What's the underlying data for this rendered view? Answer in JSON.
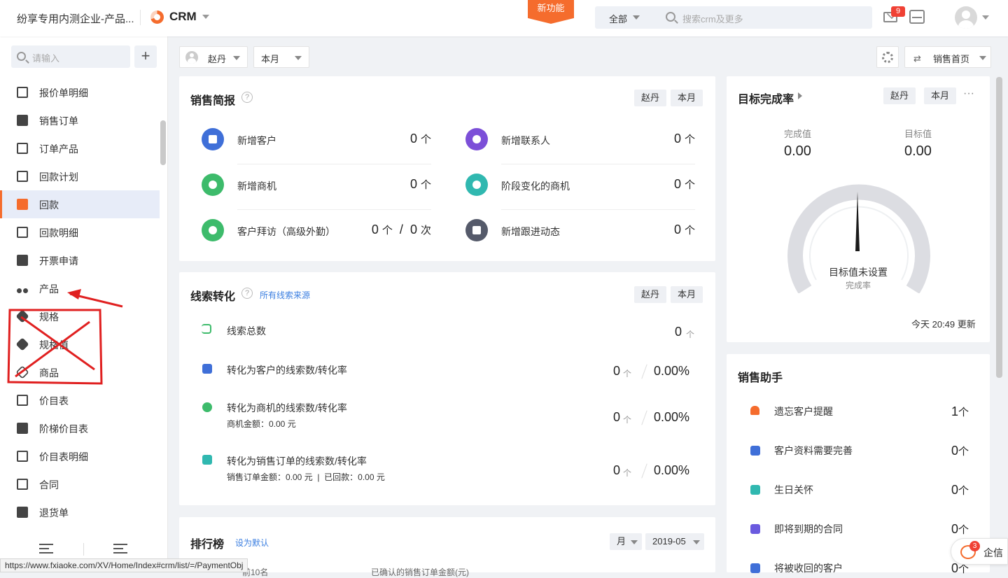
{
  "topbar": {
    "company": "纷享专用内测企业-产品...",
    "app": "CRM",
    "new_feature": "新功能",
    "search_scope": "全部",
    "search_placeholder": "搜索crm及更多",
    "mail_badge": "9"
  },
  "sidebar": {
    "search_placeholder": "请输入",
    "add_label": "+",
    "items": [
      {
        "label": "报价单明细",
        "icon": "quote-detail-icon"
      },
      {
        "label": "销售订单",
        "icon": "sales-order-icon"
      },
      {
        "label": "订单产品",
        "icon": "order-product-icon"
      },
      {
        "label": "回款计划",
        "icon": "payment-plan-icon"
      },
      {
        "label": "回款",
        "icon": "payment-icon",
        "active": true
      },
      {
        "label": "回款明细",
        "icon": "payment-detail-icon"
      },
      {
        "label": "开票申请",
        "icon": "invoice-icon"
      },
      {
        "label": "产品",
        "icon": "product-icon"
      },
      {
        "label": "规格",
        "icon": "spec-icon"
      },
      {
        "label": "规格值",
        "icon": "spec-value-icon"
      },
      {
        "label": "商品",
        "icon": "goods-icon"
      },
      {
        "label": "价目表",
        "icon": "price-list-icon"
      },
      {
        "label": "阶梯价目表",
        "icon": "tiered-price-icon"
      },
      {
        "label": "价目表明细",
        "icon": "price-detail-icon"
      },
      {
        "label": "合同",
        "icon": "contract-icon"
      },
      {
        "label": "退货单",
        "icon": "return-order-icon"
      }
    ]
  },
  "filter": {
    "person": "赵丹",
    "period": "本月",
    "home_label": "销售首页"
  },
  "sales_brief": {
    "title": "销售简报",
    "tag_person": "赵丹",
    "tag_period": "本月",
    "metrics": [
      {
        "label": "新增客户",
        "value": "0",
        "unit": "个"
      },
      {
        "label": "新增联系人",
        "value": "0",
        "unit": "个"
      },
      {
        "label": "新增商机",
        "value": "0",
        "unit": "个"
      },
      {
        "label": "阶段变化的商机",
        "value": "0",
        "unit": "个"
      },
      {
        "label": "客户拜访（高级外勤）",
        "value": "0",
        "unit": "个",
        "value2": "0",
        "unit2": "次",
        "sep": "/"
      },
      {
        "label": "新增跟进动态",
        "value": "0",
        "unit": "个"
      }
    ]
  },
  "lead": {
    "title": "线索转化",
    "source_link": "所有线索来源",
    "tag_person": "赵丹",
    "tag_period": "本月",
    "total": {
      "label": "线索总数",
      "value": "0",
      "unit": "个"
    },
    "rows": [
      {
        "label": "转化为客户的线索数/转化率",
        "sub": "",
        "value": "0",
        "unit": "个",
        "rate": "0.00%"
      },
      {
        "label": "转化为商机的线索数/转化率",
        "sub": "商机金额：0.00 元",
        "value": "0",
        "unit": "个",
        "rate": "0.00%"
      },
      {
        "label": "转化为销售订单的线索数/转化率",
        "sub": "销售订单金额：0.00 元  |  已回款：0.00 元",
        "value": "0",
        "unit": "个",
        "rate": "0.00%"
      }
    ]
  },
  "ranking": {
    "title": "排行榜",
    "set_default": "设为默认",
    "period": "月",
    "month": "2019-05",
    "col1": "前10名",
    "col2": "已确认的销售订单金额(元)"
  },
  "target": {
    "title": "目标完成率",
    "tag_person": "赵丹",
    "tag_period": "本月",
    "more": "···",
    "done_label": "完成值",
    "done_value": "0.00",
    "goal_label": "目标值",
    "goal_value": "0.00",
    "gauge_main": "目标值未设置",
    "gauge_sub": "完成率",
    "updated": "今天 20:49 更新"
  },
  "assistant": {
    "title": "销售助手",
    "items": [
      {
        "label": "遗忘客户提醒",
        "value": "1",
        "unit": "个",
        "color": "#f56c2d"
      },
      {
        "label": "客户资料需要完善",
        "value": "0",
        "unit": "个",
        "color": "#3f6fd8"
      },
      {
        "label": "生日关怀",
        "value": "0",
        "unit": "个",
        "color": "#30b8b0"
      },
      {
        "label": "即将到期的合同",
        "value": "0",
        "unit": "个",
        "color": "#6a5adf"
      },
      {
        "label": "将被收回的客户",
        "value": "0",
        "unit": "个",
        "color": "#3f6fd8"
      }
    ]
  },
  "qixin": {
    "label": "企信",
    "badge": "3"
  },
  "statusbar": {
    "url": "https://www.fxiaoke.com/XV/Home/Index#crm/list/=/PaymentObj"
  },
  "colors": {
    "accent": "#f56c2d",
    "link": "#3a7ee0",
    "annotation": "#e02020"
  }
}
